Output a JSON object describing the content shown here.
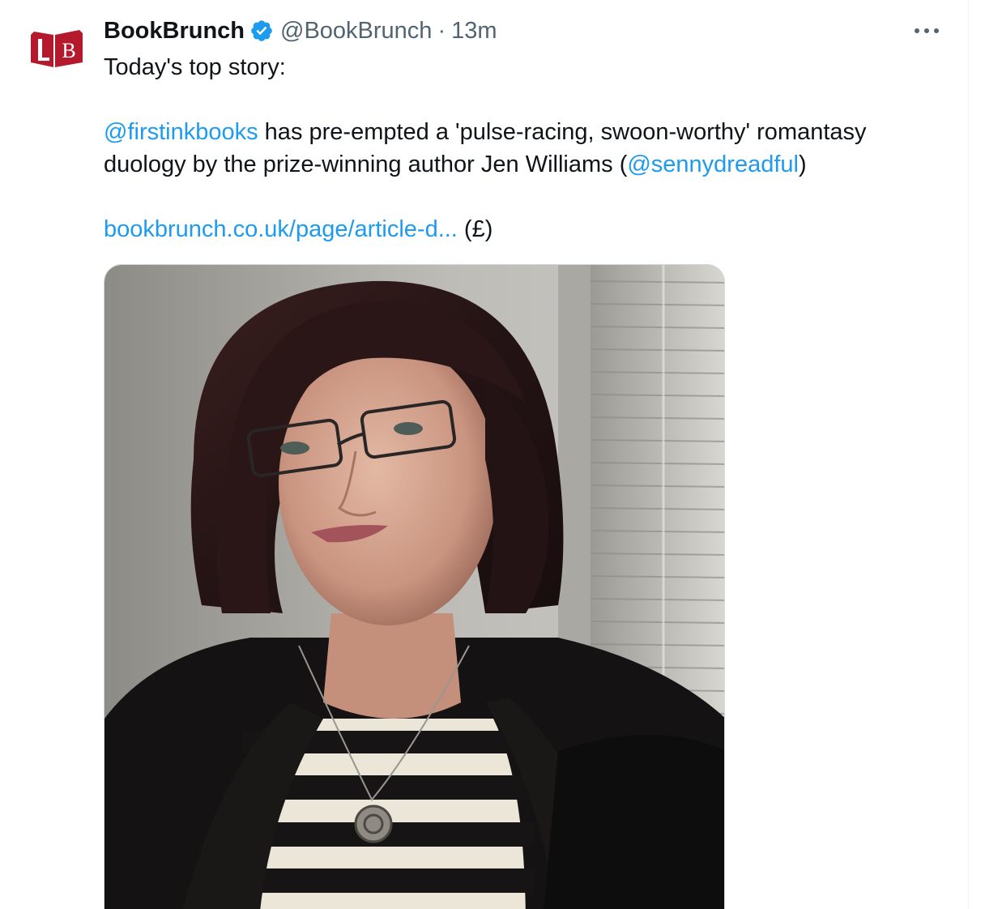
{
  "tweet": {
    "author": {
      "display_name": "BookBrunch",
      "handle": "@BookBrunch",
      "verified": true,
      "avatar_icon": "bookbrunch-lb-logo",
      "avatar_color": "#b5192e"
    },
    "separator": "·",
    "time": "13m",
    "more_icon": "more-horizontal-icon",
    "text": {
      "line1": "Today's top story:",
      "mention1": "@firstinkbooks",
      "line2_rest": " has pre-empted a 'pulse-racing, swoon-worthy' romantasy",
      "line3_start": "duology by the prize-winning author Jen Williams (",
      "mention2": "@sennydreadful",
      "line3_end": ")",
      "link": "bookbrunch.co.uk/page/article-d...",
      "link_suffix": " (£)"
    },
    "media": {
      "type": "photo"
    }
  },
  "colors": {
    "link": "#1d9bf0",
    "verified": "#1d9bf0",
    "secondary_text": "#536471"
  }
}
